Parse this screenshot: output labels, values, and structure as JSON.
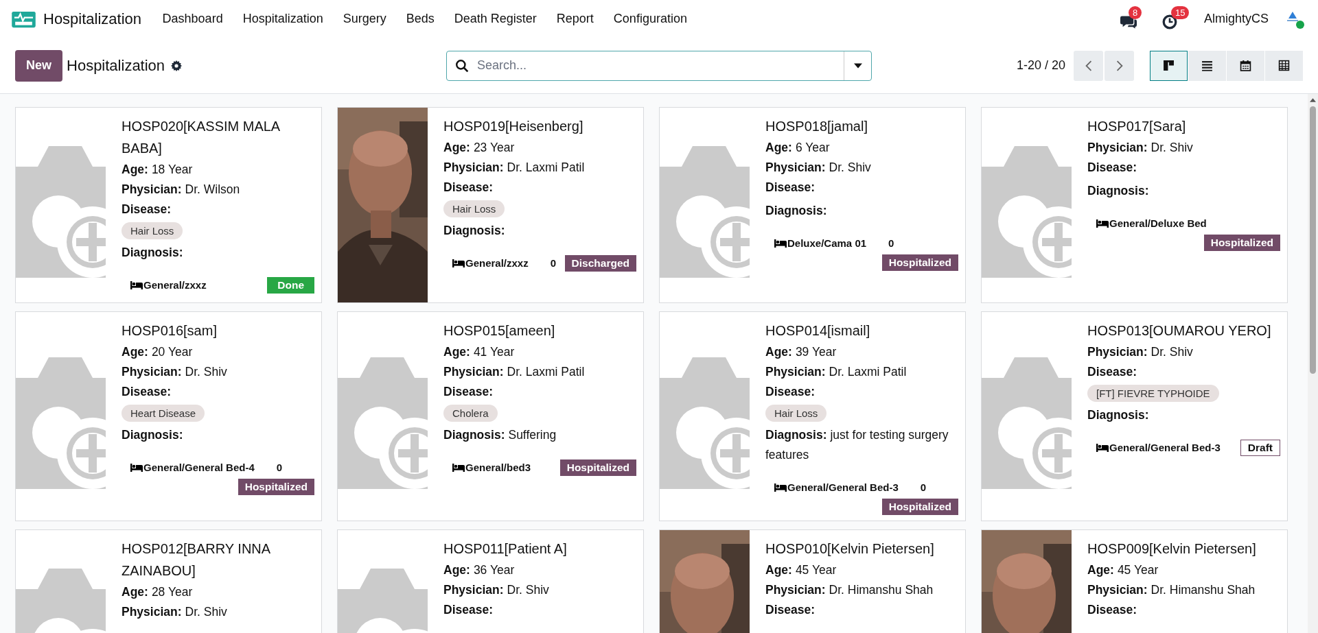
{
  "navbar": {
    "app_name": "Hospitalization",
    "menu": [
      "Dashboard",
      "Hospitalization",
      "Surgery",
      "Beds",
      "Death Register",
      "Report",
      "Configuration"
    ],
    "notifications": [
      {
        "kind": "chat",
        "count": "8"
      },
      {
        "kind": "activity",
        "count": "15"
      }
    ],
    "user": "AlmightyCS"
  },
  "control_panel": {
    "new_button": "New",
    "title": "Hospitalization",
    "search": {
      "placeholder": "Search..."
    },
    "pager": "1-20 / 20",
    "views": [
      {
        "kind": "kanban",
        "selected": true
      },
      {
        "kind": "list",
        "selected": false
      },
      {
        "kind": "calendar",
        "selected": false
      },
      {
        "kind": "pivot",
        "selected": false
      }
    ]
  },
  "cards": [
    {
      "title": "HOSP020[KASSIM MALA BABA]",
      "image": {
        "kind": "placeholder"
      },
      "fields": [
        {
          "label": "Age:",
          "value": "18 Year"
        },
        {
          "label": "Physician:",
          "value": "Dr. Wilson"
        },
        {
          "label": "Disease:",
          "tags": [
            "Hair Loss"
          ]
        },
        {
          "label": "Diagnosis:"
        }
      ],
      "bed": "General/zxxz",
      "status": {
        "kind": "done",
        "label": "Done"
      }
    },
    {
      "title": "HOSP019[Heisenberg]",
      "image": {
        "kind": "picture"
      },
      "fields": [
        {
          "label": "Age:",
          "value": "23 Year"
        },
        {
          "label": "Physician:",
          "value": "Dr. Laxmi Patil"
        },
        {
          "label": "Disease:",
          "tags": [
            "Hair Loss"
          ]
        },
        {
          "label": "Diagnosis:"
        }
      ],
      "bed": "General/zxxz",
      "count": "0",
      "status": {
        "kind": "discharged",
        "label": "Discharged"
      }
    },
    {
      "title": "HOSP018[jamal]",
      "image": {
        "kind": "placeholder"
      },
      "fields": [
        {
          "label": "Age:",
          "value": "6 Year"
        },
        {
          "label": "Physician:",
          "value": "Dr. Shiv"
        },
        {
          "label": "Disease:"
        },
        {
          "label": "Diagnosis:"
        }
      ],
      "bed": "Deluxe/Cama 01",
      "count": "0",
      "status": {
        "kind": "hospitalized",
        "label": "Hospitalized"
      }
    },
    {
      "title": "HOSP017[Sara]",
      "image": {
        "kind": "placeholder"
      },
      "fields": [
        {
          "label": "Physician:",
          "value": "Dr. Shiv"
        },
        {
          "label": "Disease:"
        },
        {
          "label": "Diagnosis:"
        }
      ],
      "bed": "General/Deluxe Bed",
      "status": {
        "kind": "hospitalized",
        "label": "Hospitalized"
      }
    },
    {
      "title": "HOSP016[sam]",
      "image": {
        "kind": "placeholder"
      },
      "fields": [
        {
          "label": "Age:",
          "value": "20 Year"
        },
        {
          "label": "Physician:",
          "value": "Dr. Shiv"
        },
        {
          "label": "Disease:",
          "tags": [
            "Heart Disease"
          ]
        },
        {
          "label": "Diagnosis:"
        }
      ],
      "bed": "General/General Bed-4",
      "count": "0",
      "status": {
        "kind": "hospitalized",
        "label": "Hospitalized"
      }
    },
    {
      "title": "HOSP015[ameen]",
      "image": {
        "kind": "placeholder"
      },
      "fields": [
        {
          "label": "Age:",
          "value": "41 Year"
        },
        {
          "label": "Physician:",
          "value": "Dr. Laxmi Patil"
        },
        {
          "label": "Disease:",
          "tags": [
            "Cholera"
          ]
        },
        {
          "label": "Diagnosis:",
          "value": "Suffering"
        }
      ],
      "bed": "General/bed3",
      "status": {
        "kind": "hospitalized",
        "label": "Hospitalized"
      }
    },
    {
      "title": "HOSP014[ismail]",
      "image": {
        "kind": "placeholder"
      },
      "fields": [
        {
          "label": "Age:",
          "value": "39 Year"
        },
        {
          "label": "Physician:",
          "value": "Dr. Laxmi Patil"
        },
        {
          "label": "Disease:",
          "tags": [
            "Hair Loss"
          ]
        },
        {
          "label": "Diagnosis:",
          "value": "just for testing surgery features"
        }
      ],
      "bed": "General/General Bed-3",
      "count": "0",
      "status": {
        "kind": "hospitalized",
        "label": "Hospitalized"
      }
    },
    {
      "title": "HOSP013[OUMAROU YERO]",
      "image": {
        "kind": "placeholder"
      },
      "fields": [
        {
          "label": "Physician:",
          "value": "Dr. Shiv"
        },
        {
          "label": "Disease:",
          "tags": [
            "[FT] FIEVRE TYPHOIDE"
          ]
        },
        {
          "label": "Diagnosis:"
        }
      ],
      "bed": "General/General Bed-3",
      "status": {
        "kind": "draft",
        "label": "Draft"
      }
    },
    {
      "title": "HOSP012[BARRY INNA ZAINABOU]",
      "image": {
        "kind": "placeholder"
      },
      "fields": [
        {
          "label": "Age:",
          "value": "28 Year"
        },
        {
          "label": "Physician:",
          "value": "Dr. Shiv"
        }
      ]
    },
    {
      "title": "HOSP011[Patient A]",
      "image": {
        "kind": "placeholder"
      },
      "fields": [
        {
          "label": "Age:",
          "value": "36 Year"
        },
        {
          "label": "Physician:",
          "value": "Dr. Shiv"
        },
        {
          "label": "Disease:"
        }
      ]
    },
    {
      "title": "HOSP010[Kelvin Pietersen]",
      "image": {
        "kind": "picture"
      },
      "fields": [
        {
          "label": "Age:",
          "value": "45 Year"
        },
        {
          "label": "Physician:",
          "value": "Dr. Himanshu Shah"
        },
        {
          "label": "Disease:"
        }
      ]
    },
    {
      "title": "HOSP009[Kelvin Pietersen]",
      "image": {
        "kind": "picture"
      },
      "fields": [
        {
          "label": "Age:",
          "value": "45 Year"
        },
        {
          "label": "Physician:",
          "value": "Dr. Himanshu Shah"
        },
        {
          "label": "Disease:"
        }
      ]
    }
  ]
}
